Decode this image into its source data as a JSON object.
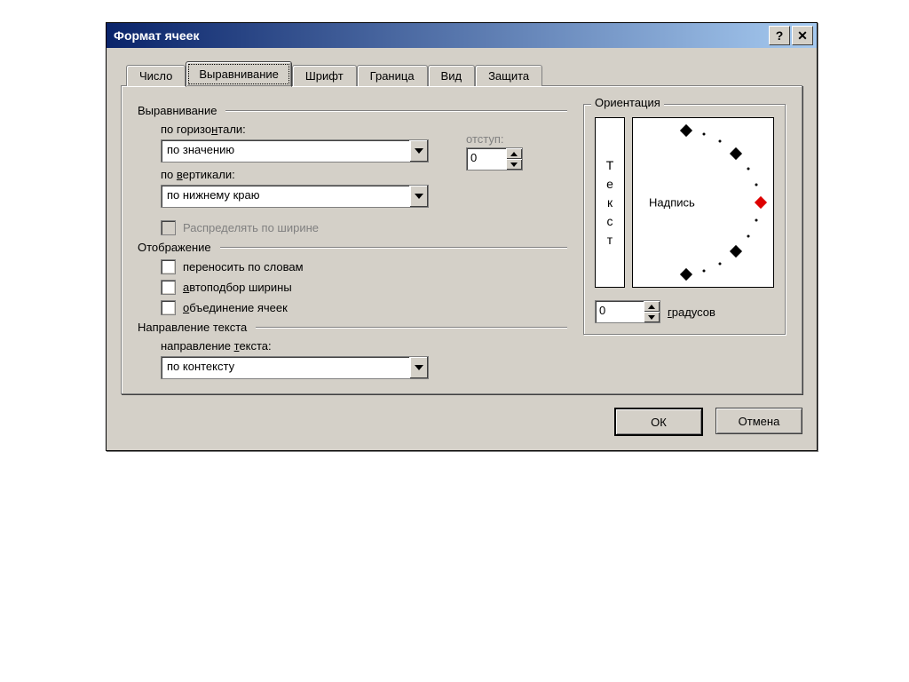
{
  "title": "Формат ячеек",
  "tabs": {
    "number": "Число",
    "alignment": "Выравнивание",
    "font": "Шрифт",
    "border": "Граница",
    "view": "Вид",
    "protection": "Защита"
  },
  "groups": {
    "alignment": "Выравнивание",
    "display": "Отображение",
    "textdir": "Направление текста",
    "orientation": "Ориентация"
  },
  "labels": {
    "horizontal_pre": "по горизо",
    "horizontal_u": "н",
    "horizontal_post": "тали:",
    "vertical_pre": "по ",
    "vertical_u": "в",
    "vertical_post": "ертикали:",
    "indent": "отступ:",
    "distribute": "Распределять по ширине",
    "wrap": "переносить по словам",
    "shrink_pre": "",
    "shrink_u": "а",
    "shrink_post": "втоподбор ширины",
    "merge_pre": "",
    "merge_u": "о",
    "merge_post": "бъединение ячеек",
    "textdir_pre": "направление ",
    "textdir_u": "т",
    "textdir_post": "екста:",
    "degrees_pre": "",
    "degrees_u": "г",
    "degrees_post": "радусов",
    "nadpis": "Надпись"
  },
  "values": {
    "horizontal": "по значению",
    "vertical": "по нижнему краю",
    "indent": "0",
    "textdir": "по контексту",
    "degrees": "0"
  },
  "vtext": {
    "c0": "Т",
    "c1": "е",
    "c2": "к",
    "c3": "с",
    "c4": "т"
  },
  "buttons": {
    "ok": "ОК",
    "cancel": "Отмена",
    "help": "?",
    "close": "✕"
  }
}
